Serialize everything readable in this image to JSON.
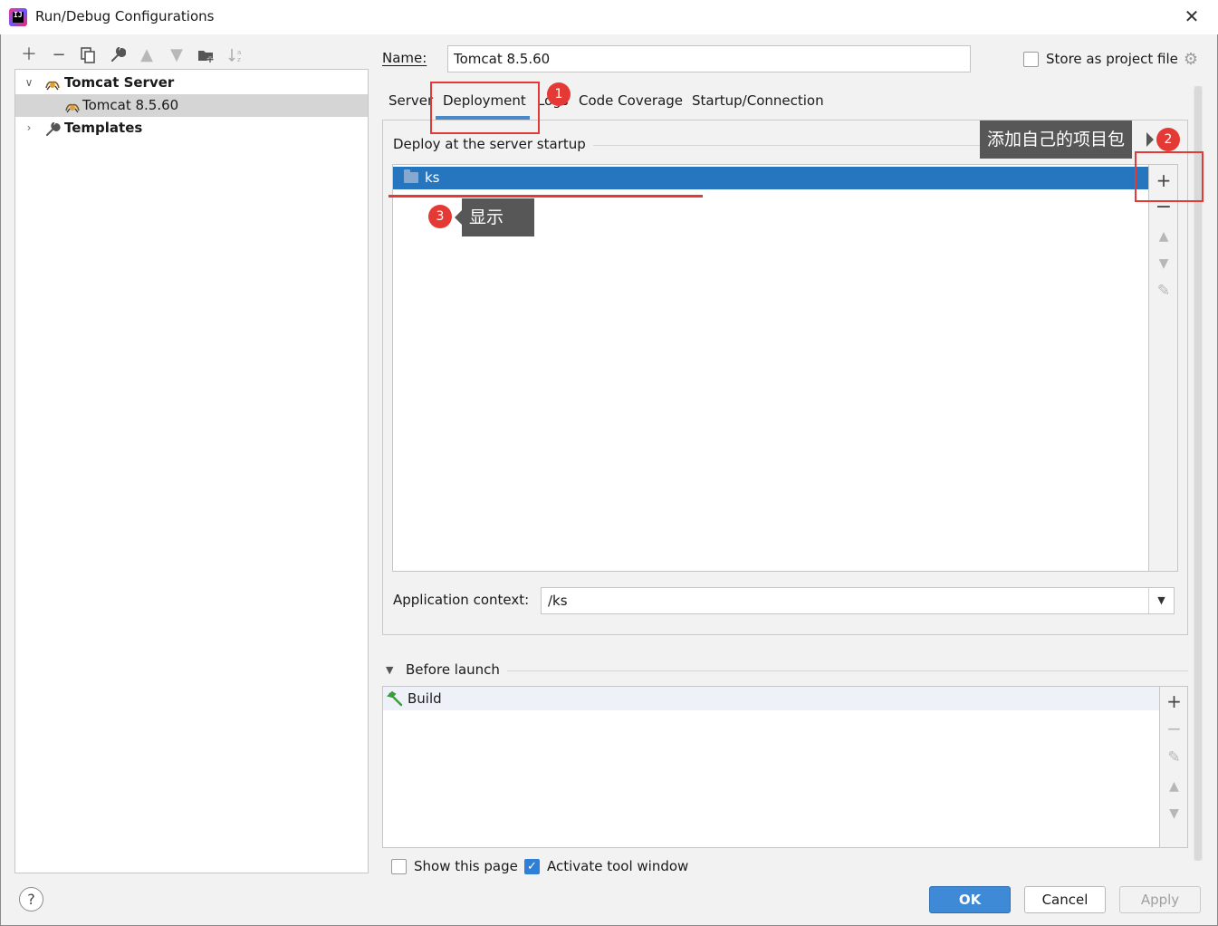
{
  "window": {
    "title": "Run/Debug Configurations"
  },
  "tree": {
    "group_label": "Tomcat Server",
    "config_label": "Tomcat 8.5.60",
    "templates_label": "Templates"
  },
  "form": {
    "name_label": "Name:",
    "name_value": "Tomcat 8.5.60",
    "store_label": "Store as project file"
  },
  "tabs": [
    "Server",
    "Deployment",
    "Logs",
    "Code Coverage",
    "Startup/Connection"
  ],
  "deploy": {
    "group_title": "Deploy at the server startup",
    "items": [
      "ks"
    ],
    "context_label": "Application context:",
    "context_value": "/ks"
  },
  "before_launch": {
    "title": "Before launch",
    "items": [
      "Build"
    ]
  },
  "bottom": {
    "show_page_label": "Show this page",
    "activate_label": "Activate tool window"
  },
  "buttons": {
    "ok": "OK",
    "cancel": "Cancel",
    "apply": "Apply"
  },
  "help_glyph": "?",
  "annotations": {
    "marker1": "1",
    "marker2": "2",
    "marker3": "3",
    "tip2": "添加自己的项目包",
    "tip3": "显示"
  },
  "colors": {
    "selection": "#2675bf",
    "accent": "#4a88c7",
    "annotation_red": "#e53935",
    "tooltip_bg": "#575757",
    "ok_button": "#3e8ad6"
  }
}
